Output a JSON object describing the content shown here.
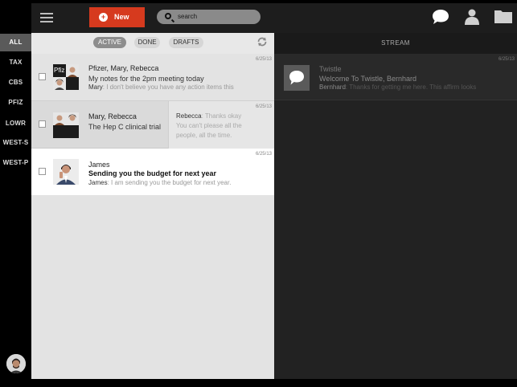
{
  "rail": {
    "items": [
      {
        "label": "ALL",
        "active": true
      },
      {
        "label": "TAX",
        "active": false
      },
      {
        "label": "CBS",
        "active": false
      },
      {
        "label": "PFIZ",
        "active": false
      },
      {
        "label": "LOWR",
        "active": false
      },
      {
        "label": "WEST-S",
        "active": false
      },
      {
        "label": "WEST-P",
        "active": false
      }
    ]
  },
  "topbar": {
    "new_label": "New",
    "search_placeholder": "search"
  },
  "filters": {
    "active": "ACTIVE",
    "done": "DONE",
    "drafts": "DRAFTS"
  },
  "threads": [
    {
      "participants": "Pfizer, Mary, Rebecca",
      "thumb_label": "Pfiz",
      "subject": "My notes for the 2pm meeting today",
      "sender": "Mary",
      "preview": ": I don't believe you have any action items this",
      "time": "6/25/13"
    },
    {
      "participants": "Mary, Rebecca",
      "subject": "The Hep C clinical trial",
      "time": "6/25/13",
      "side_sender": "Rebecca",
      "side_preview_1": ": Thanks okay",
      "side_preview_2": "You can't please all the",
      "side_preview_3": "people, all the time."
    },
    {
      "participants": "James",
      "subject": "Sending you the budget for next year",
      "sender": "James",
      "preview": ": I am sending you the budget for next year.",
      "time": "6/25/13"
    }
  ],
  "stream": {
    "header": "STREAM",
    "item": {
      "title": "Twistle",
      "subject": "Welcome To Twistle, Bernhard",
      "sender": "Bernhard",
      "preview": ": Thanks for getting me here. This affirm looks",
      "time": "6/25/13"
    }
  },
  "colors": {
    "accent": "#d63a1e",
    "topbar": "#1d1d1d",
    "stream_bg": "#222222",
    "list_bg": "#e3e3e3"
  }
}
